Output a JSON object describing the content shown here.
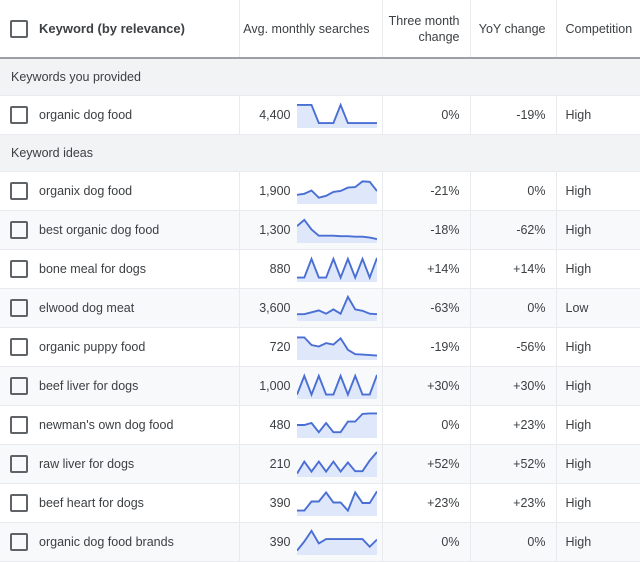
{
  "table": {
    "columns": [
      {
        "key": "select",
        "label": "",
        "icon": "checkbox-icon"
      },
      {
        "key": "keyword",
        "label": "Keyword (by relevance)"
      },
      {
        "key": "avg_monthly_searches",
        "label": "Avg. monthly searches"
      },
      {
        "key": "three_month_change",
        "label": "Three month change"
      },
      {
        "key": "yoy_change",
        "label": "YoY change"
      },
      {
        "key": "competition",
        "label": "Competition"
      }
    ],
    "colors": {
      "spark_line": "#4a6fd4",
      "spark_fill": "#dfe8fb",
      "header_border": "#9aa0a6",
      "section_bg": "#f1f3f4",
      "row_alt_bg": "#f8f9fa",
      "grid_line": "#e8eaed",
      "text": "#3c4043",
      "checkbox_border": "#5f6368"
    },
    "sections": [
      {
        "title": "Keywords you provided",
        "rows": [
          {
            "keyword": "organic dog food",
            "avg_monthly_searches": "4,400",
            "three_month_change": "0%",
            "yoy_change": "-19%",
            "competition": "High",
            "sparkline": [
              88,
              88,
              88,
              12,
              12,
              12,
              88,
              12,
              12,
              12,
              12,
              12
            ]
          }
        ]
      },
      {
        "title": "Keyword ideas",
        "rows": [
          {
            "keyword": "organix dog food",
            "avg_monthly_searches": "1,900",
            "three_month_change": "-21%",
            "yoy_change": "0%",
            "competition": "High",
            "sparkline": [
              30,
              34,
              48,
              18,
              26,
              42,
              46,
              60,
              62,
              86,
              84,
              46
            ]
          },
          {
            "keyword": "best organic dog food",
            "avg_monthly_searches": "1,300",
            "three_month_change": "-18%",
            "yoy_change": "-62%",
            "competition": "High",
            "sparkline": [
              62,
              88,
              48,
              22,
              22,
              22,
              20,
              20,
              18,
              18,
              14,
              8
            ]
          },
          {
            "keyword": "bone meal for dogs",
            "avg_monthly_searches": "880",
            "three_month_change": "+14%",
            "yoy_change": "+14%",
            "competition": "High",
            "sparkline": [
              10,
              10,
              88,
              10,
              10,
              88,
              10,
              88,
              10,
              88,
              10,
              92
            ]
          },
          {
            "keyword": "elwood dog meat",
            "avg_monthly_searches": "3,600",
            "three_month_change": "-63%",
            "yoy_change": "0%",
            "competition": "Low",
            "sparkline": [
              20,
              20,
              28,
              36,
              22,
              40,
              22,
              92,
              40,
              34,
              22,
              20
            ]
          },
          {
            "keyword": "organic puppy food",
            "avg_monthly_searches": "720",
            "three_month_change": "-19%",
            "yoy_change": "-56%",
            "competition": "High",
            "sparkline": [
              86,
              86,
              54,
              48,
              62,
              56,
              82,
              34,
              16,
              14,
              12,
              10
            ]
          },
          {
            "keyword": "beef liver for dogs",
            "avg_monthly_searches": "1,000",
            "three_month_change": "+30%",
            "yoy_change": "+30%",
            "competition": "High",
            "sparkline": [
              10,
              88,
              10,
              88,
              10,
              10,
              88,
              10,
              88,
              10,
              10,
              92
            ]
          },
          {
            "keyword": "newman's own dog food",
            "avg_monthly_searches": "480",
            "three_month_change": "0%",
            "yoy_change": "+23%",
            "competition": "High",
            "sparkline": [
              46,
              46,
              54,
              16,
              54,
              16,
              16,
              60,
              60,
              92,
              94,
              94
            ]
          },
          {
            "keyword": "raw liver for dogs",
            "avg_monthly_searches": "210",
            "three_month_change": "+52%",
            "yoy_change": "+52%",
            "competition": "High",
            "sparkline": [
              6,
              56,
              14,
              56,
              14,
              56,
              14,
              52,
              16,
              16,
              60,
              96
            ]
          },
          {
            "keyword": "beef heart for dogs",
            "avg_monthly_searches": "390",
            "three_month_change": "+23%",
            "yoy_change": "+23%",
            "competition": "High",
            "sparkline": [
              14,
              14,
              52,
              52,
              90,
              48,
              48,
              14,
              90,
              46,
              46,
              94
            ]
          },
          {
            "keyword": "organic dog food brands",
            "avg_monthly_searches": "390",
            "three_month_change": "0%",
            "yoy_change": "0%",
            "competition": "High",
            "sparkline": [
              10,
              48,
              92,
              40,
              58,
              58,
              58,
              58,
              58,
              58,
              26,
              56
            ]
          }
        ]
      }
    ]
  }
}
